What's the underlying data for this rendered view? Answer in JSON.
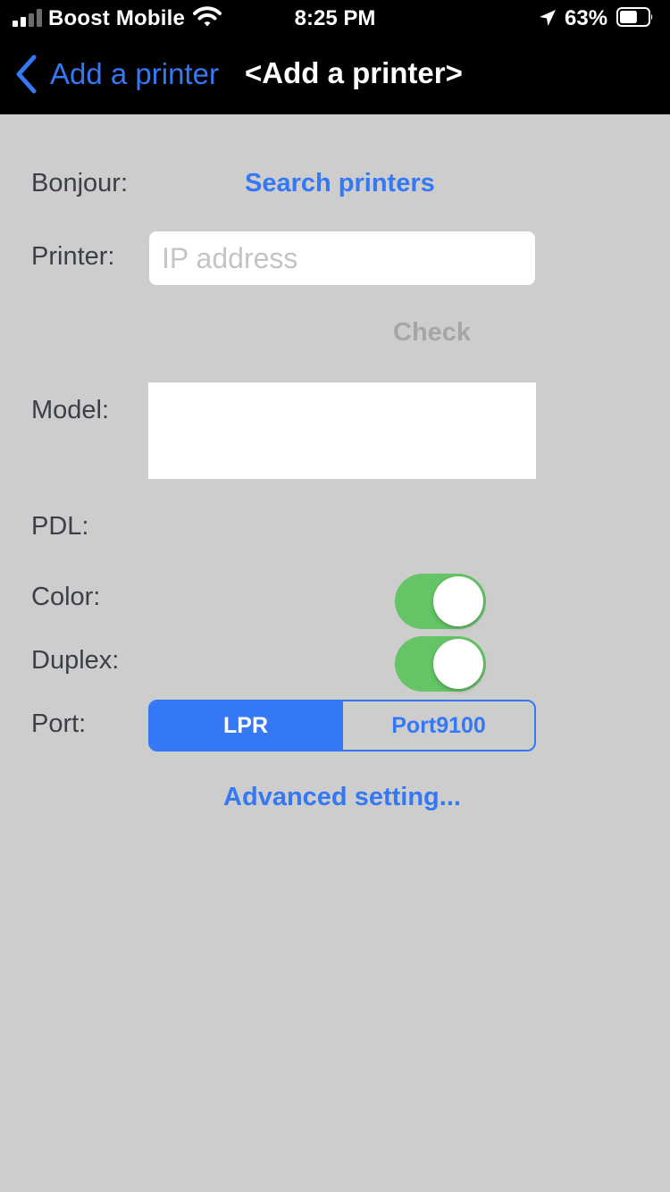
{
  "status_bar": {
    "carrier": "Boost Mobile",
    "time": "8:25 PM",
    "battery_percent": "63%",
    "battery_level": 0.63,
    "signal_bars_active": 2,
    "signal_bars_total": 4
  },
  "nav": {
    "back_label": "Add a printer",
    "title": "<Add a printer>"
  },
  "form": {
    "bonjour_label": "Bonjour:",
    "search_printers": "Search printers",
    "printer_label": "Printer:",
    "ip_value": "",
    "ip_placeholder": "IP address",
    "check_label": "Check",
    "model_label": "Model:",
    "model_value": "",
    "pdl_label": "PDL:",
    "color_label": "Color:",
    "color_enabled": true,
    "duplex_label": "Duplex:",
    "duplex_enabled": true,
    "port_label": "Port:",
    "port_options": [
      "LPR",
      "Port9100"
    ],
    "port_selected": "LPR",
    "advanced_setting": "Advanced setting..."
  },
  "colors": {
    "accent": "#3478f6",
    "toggle_on": "#65c466",
    "background": "#cdcdcd",
    "nav_background": "#000000",
    "label_text": "#3b3f48",
    "disabled_text": "#a6a6a6"
  },
  "icons": {
    "back": "chevron-left-icon",
    "signal": "cellular-signal-icon",
    "wifi": "wifi-icon",
    "location": "location-arrow-icon",
    "battery": "battery-icon"
  }
}
